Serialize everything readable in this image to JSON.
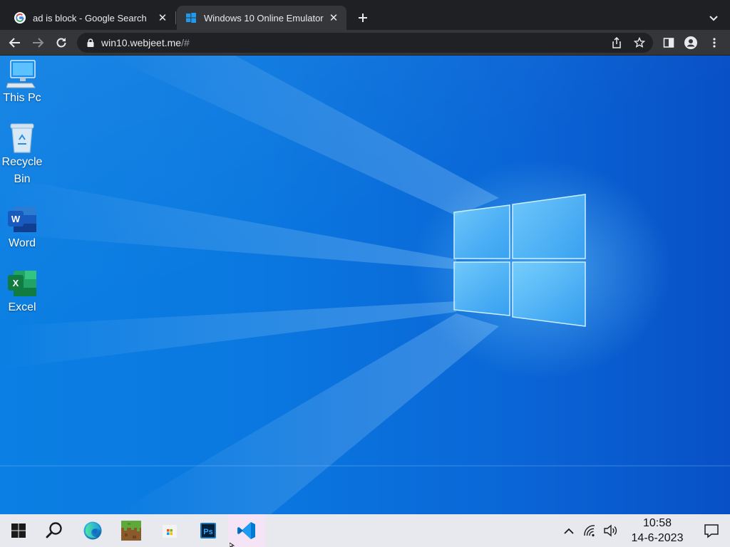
{
  "browser": {
    "tabs": [
      {
        "title": "ad is block - Google Search",
        "favicon": "google-g-icon",
        "active": false
      },
      {
        "title": "Windows 10 Online Emulator",
        "favicon": "windows-logo-icon",
        "active": true
      }
    ],
    "url_host": "win10.webjeet.me",
    "url_rest": "/#"
  },
  "desktop": {
    "icons": [
      {
        "label": "This Pc",
        "icon": "monitor-icon"
      },
      {
        "label": "Recycle\nBin",
        "icon": "recycle-bin-icon"
      },
      {
        "label": "Word",
        "icon": "word-icon"
      },
      {
        "label": "Excel",
        "icon": "excel-icon"
      }
    ]
  },
  "taskbar": {
    "apps": [
      "start-icon",
      "search-icon",
      "edge-icon",
      "minecraft-icon",
      "store-icon",
      "photoshop-icon",
      "vscode-icon"
    ],
    "photoshop_text": "Ps",
    "clock": {
      "time": "10:58",
      "date": "14-6-2023"
    }
  },
  "colors": {
    "desktop_accent": "#0a78e0",
    "taskbar_bg": "#e7e9ee",
    "chrome_bg": "#35363a"
  }
}
